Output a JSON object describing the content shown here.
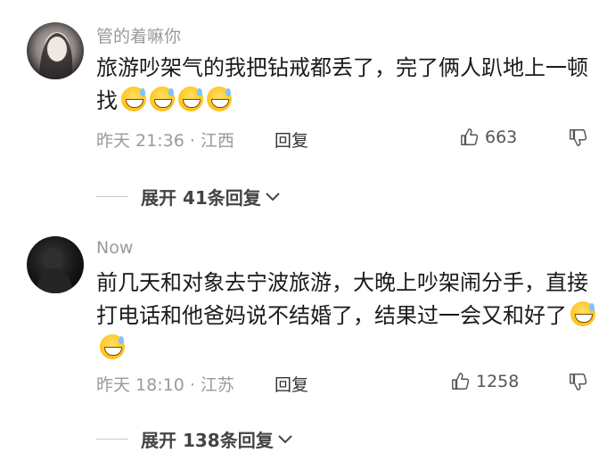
{
  "comments": [
    {
      "username": "管的着嘛你",
      "text": "旅游吵架气的我把钻戒都丢了，完了俩人趴地上一顿找",
      "emoji_count": 4,
      "time": "昨天 21:36 · 江西",
      "reply_label": "回复",
      "likes": "663",
      "expand_label": "展开 41条回复"
    },
    {
      "username": "Now",
      "text": "前几天和对象去宁波旅游，大晚上吵架闹分手，直接打电话和他爸妈说不结婚了，结果过一会又和好了",
      "emoji_count": 2,
      "time": "昨天 18:10 · 江苏",
      "reply_label": "回复",
      "likes": "1258",
      "expand_label": "展开 138条回复"
    }
  ]
}
